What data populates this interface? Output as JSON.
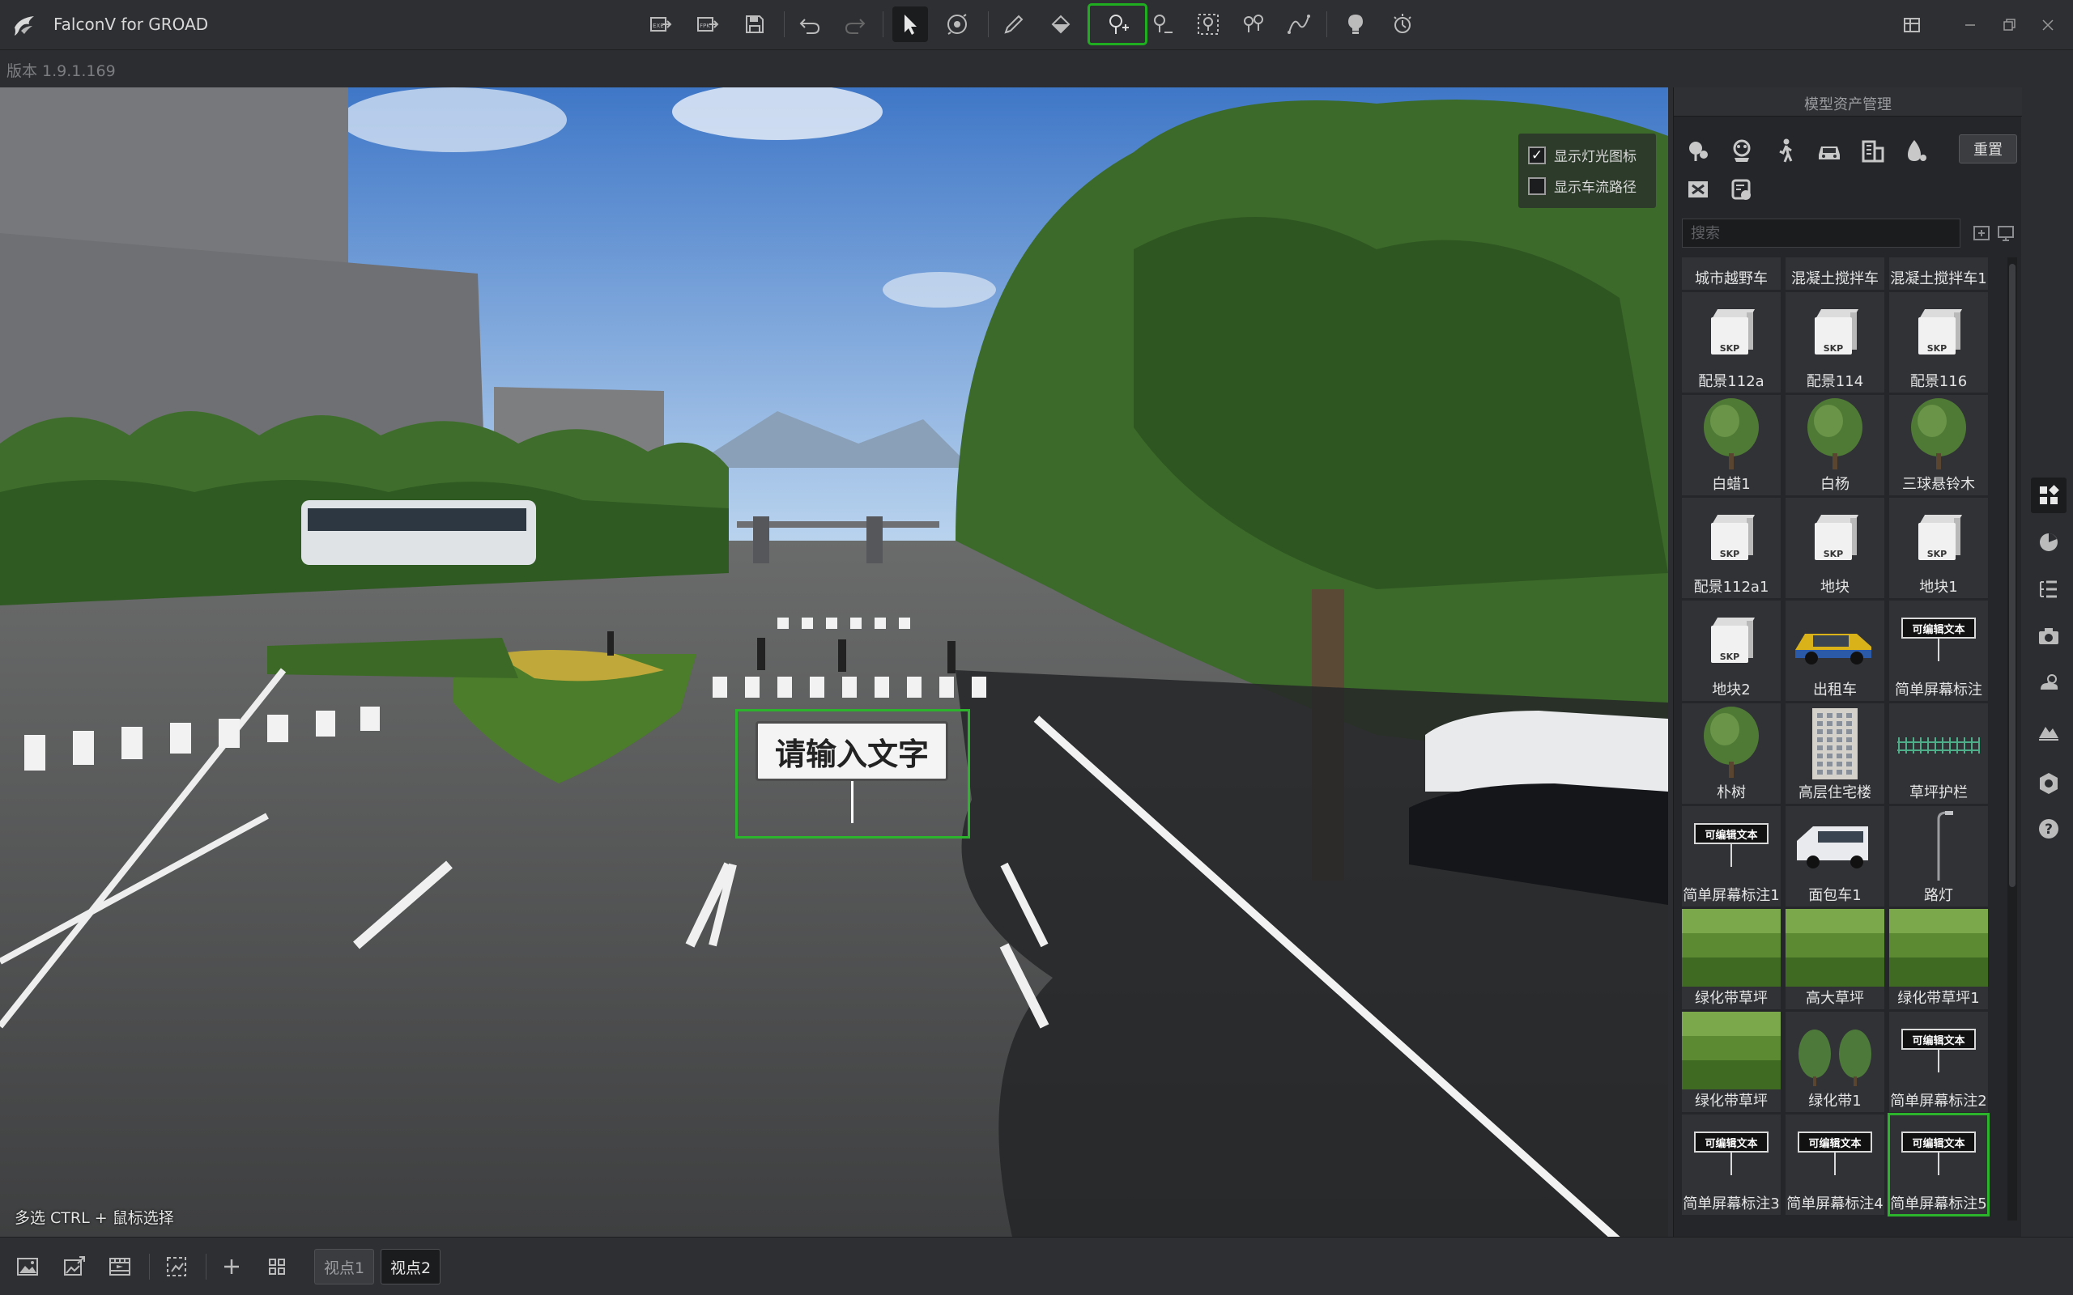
{
  "app": {
    "title": "FalconV for GROAD",
    "version": "版本 1.9.1.169"
  },
  "viewport": {
    "overlay": {
      "show_light_icons": "显示灯光图标",
      "show_traffic_path": "显示车流路径",
      "show_light_icons_checked": true,
      "show_traffic_path_checked": false
    },
    "text_annotation": "请输入文字",
    "hint": "多选    CTRL + 鼠标选择"
  },
  "asset_panel": {
    "title": "模型资产管理",
    "reset_label": "重置",
    "search_placeholder": "搜索",
    "tiles": [
      {
        "label": "城市越野车",
        "kind": "vehicle"
      },
      {
        "label": "混凝土搅拌车",
        "kind": "vehicle"
      },
      {
        "label": "混凝土搅拌车1",
        "kind": "vehicle"
      },
      {
        "label": "配景112a",
        "kind": "skp"
      },
      {
        "label": "配景114",
        "kind": "skp"
      },
      {
        "label": "配景116",
        "kind": "skp"
      },
      {
        "label": "白蜡1",
        "kind": "tree"
      },
      {
        "label": "白杨",
        "kind": "tree"
      },
      {
        "label": "三球悬铃木",
        "kind": "tree"
      },
      {
        "label": "配景112a1",
        "kind": "skp"
      },
      {
        "label": "地块",
        "kind": "skp"
      },
      {
        "label": "地块1",
        "kind": "skp"
      },
      {
        "label": "地块2",
        "kind": "skp"
      },
      {
        "label": "出租车",
        "kind": "taxi"
      },
      {
        "label": "简单屏幕标注",
        "kind": "note"
      },
      {
        "label": "朴树",
        "kind": "tree"
      },
      {
        "label": "高层住宅楼",
        "kind": "building"
      },
      {
        "label": "草坪护栏",
        "kind": "fence"
      },
      {
        "label": "简单屏幕标注1",
        "kind": "note"
      },
      {
        "label": "面包车1",
        "kind": "van"
      },
      {
        "label": "路灯",
        "kind": "lamp"
      },
      {
        "label": "绿化带草坪",
        "kind": "grass"
      },
      {
        "label": "高大草坪",
        "kind": "grass"
      },
      {
        "label": "绿化带草坪1",
        "kind": "grass"
      },
      {
        "label": "绿化带草坪",
        "kind": "grass"
      },
      {
        "label": "绿化带1",
        "kind": "shrubs"
      },
      {
        "label": "简单屏幕标注2",
        "kind": "note"
      },
      {
        "label": "简单屏幕标注3",
        "kind": "note"
      },
      {
        "label": "简单屏幕标注4",
        "kind": "note"
      },
      {
        "label": "简单屏幕标注5",
        "kind": "note",
        "selected": true
      }
    ],
    "note_thumb_text": "可编辑文本",
    "skp_text": "SKP"
  },
  "bottom": {
    "viewpoints": [
      "视点1",
      "视点2"
    ],
    "active_viewpoint": "视点2"
  },
  "colors": {
    "accent_green": "#2cb52c",
    "bg_dark": "#2b2d30",
    "panel": "#252629"
  }
}
